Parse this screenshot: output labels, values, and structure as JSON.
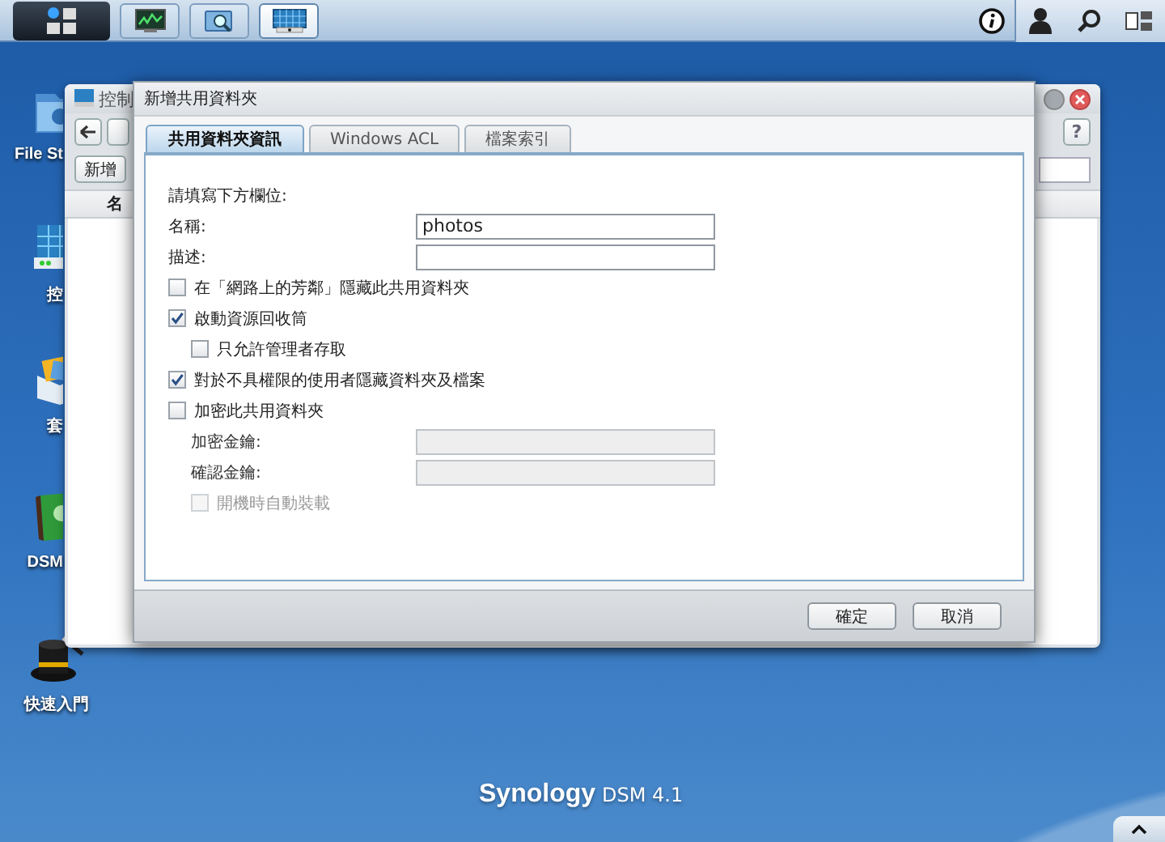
{
  "taskbar": {
    "apps": [
      {
        "kind": "monitor",
        "selected": false
      },
      {
        "kind": "search",
        "selected": false
      },
      {
        "kind": "control-panel",
        "selected": true
      }
    ]
  },
  "desktop_icons": [
    {
      "kind": "file-station",
      "label": "File St"
    },
    {
      "kind": "control-panel",
      "label": "控"
    },
    {
      "kind": "package",
      "label": "套"
    },
    {
      "kind": "help",
      "label": "DSM"
    },
    {
      "kind": "quick-start",
      "label": "快速入門"
    }
  ],
  "background_window": {
    "title": "控制",
    "toolbar_button": "新增",
    "column_1": "名",
    "help_button": "?"
  },
  "dialog": {
    "title": "新增共用資料夾",
    "tabs": [
      {
        "label": "共用資料夾資訊",
        "selected": true
      },
      {
        "label": "Windows ACL",
        "selected": false
      },
      {
        "label": "檔案索引",
        "selected": false
      }
    ],
    "intro": "請填寫下方欄位:",
    "rows": [
      {
        "kind": "field",
        "label": "名稱:",
        "value": "photos",
        "disabled": false
      },
      {
        "kind": "field",
        "label": "描述:",
        "disabled": false
      },
      {
        "kind": "checkbox",
        "label": "在「網路上的芳鄰」隱藏此共用資料夾",
        "checked": false,
        "disabled": false
      },
      {
        "kind": "checkbox",
        "label": "啟動資源回收筒",
        "checked": true,
        "disabled": false,
        "children": [
          {
            "kind": "checkbox",
            "label": "只允許管理者存取",
            "checked": false,
            "disabled": false
          }
        ]
      },
      {
        "kind": "checkbox",
        "label": "對於不具權限的使用者隱藏資料夾及檔案",
        "checked": true,
        "disabled": false
      },
      {
        "kind": "checkbox",
        "label": "加密此共用資料夾",
        "checked": false,
        "disabled": false,
        "children": [
          {
            "kind": "field",
            "label": "加密金鑰:",
            "disabled": true
          },
          {
            "kind": "field",
            "label": "確認金鑰:",
            "disabled": true
          },
          {
            "kind": "checkbox",
            "label": "開機時自動裝載",
            "checked": false,
            "disabled": true
          }
        ]
      }
    ],
    "buttons": [
      {
        "label": "確定"
      },
      {
        "label": "取消"
      }
    ]
  },
  "brand": {
    "name": "Synology",
    "version": "DSM 4.1"
  }
}
